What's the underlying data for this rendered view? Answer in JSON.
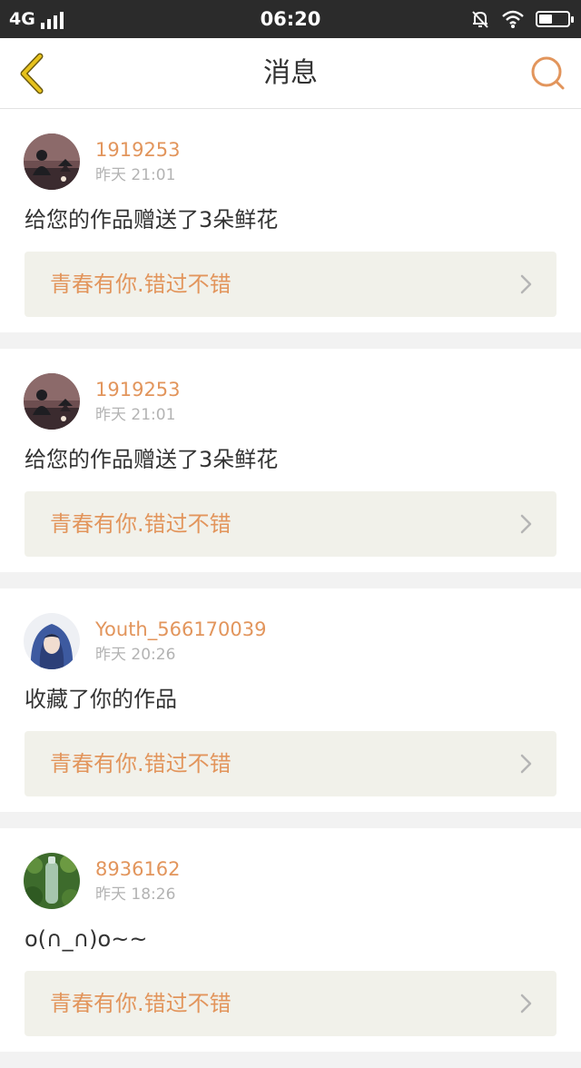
{
  "status_bar": {
    "network": "4G",
    "time": "06:20",
    "icons": [
      "signal-icon",
      "mute-bell-icon",
      "wifi-icon",
      "battery-icon"
    ],
    "battery_level": 0.45
  },
  "header": {
    "title": "消息",
    "back_icon": "chevron-left-icon",
    "search_icon": "search-icon",
    "accent_color": "#e2955c",
    "back_color": "#e7c21b"
  },
  "messages": [
    {
      "username": "1919253",
      "time": "昨天 21:01",
      "text": "给您的作品赠送了3朵鲜花",
      "work_title": "青春有你.错过不错"
    },
    {
      "username": "1919253",
      "time": "昨天 21:01",
      "text": "给您的作品赠送了3朵鲜花",
      "work_title": "青春有你.错过不错"
    },
    {
      "username": "Youth_566170039",
      "time": "昨天 20:26",
      "text": "收藏了你的作品",
      "work_title": "青春有你.错过不错"
    },
    {
      "username": "8936162",
      "time": "昨天 18:26",
      "text": "o(∩_∩)o~~",
      "work_title": "青春有你.错过不错"
    }
  ]
}
